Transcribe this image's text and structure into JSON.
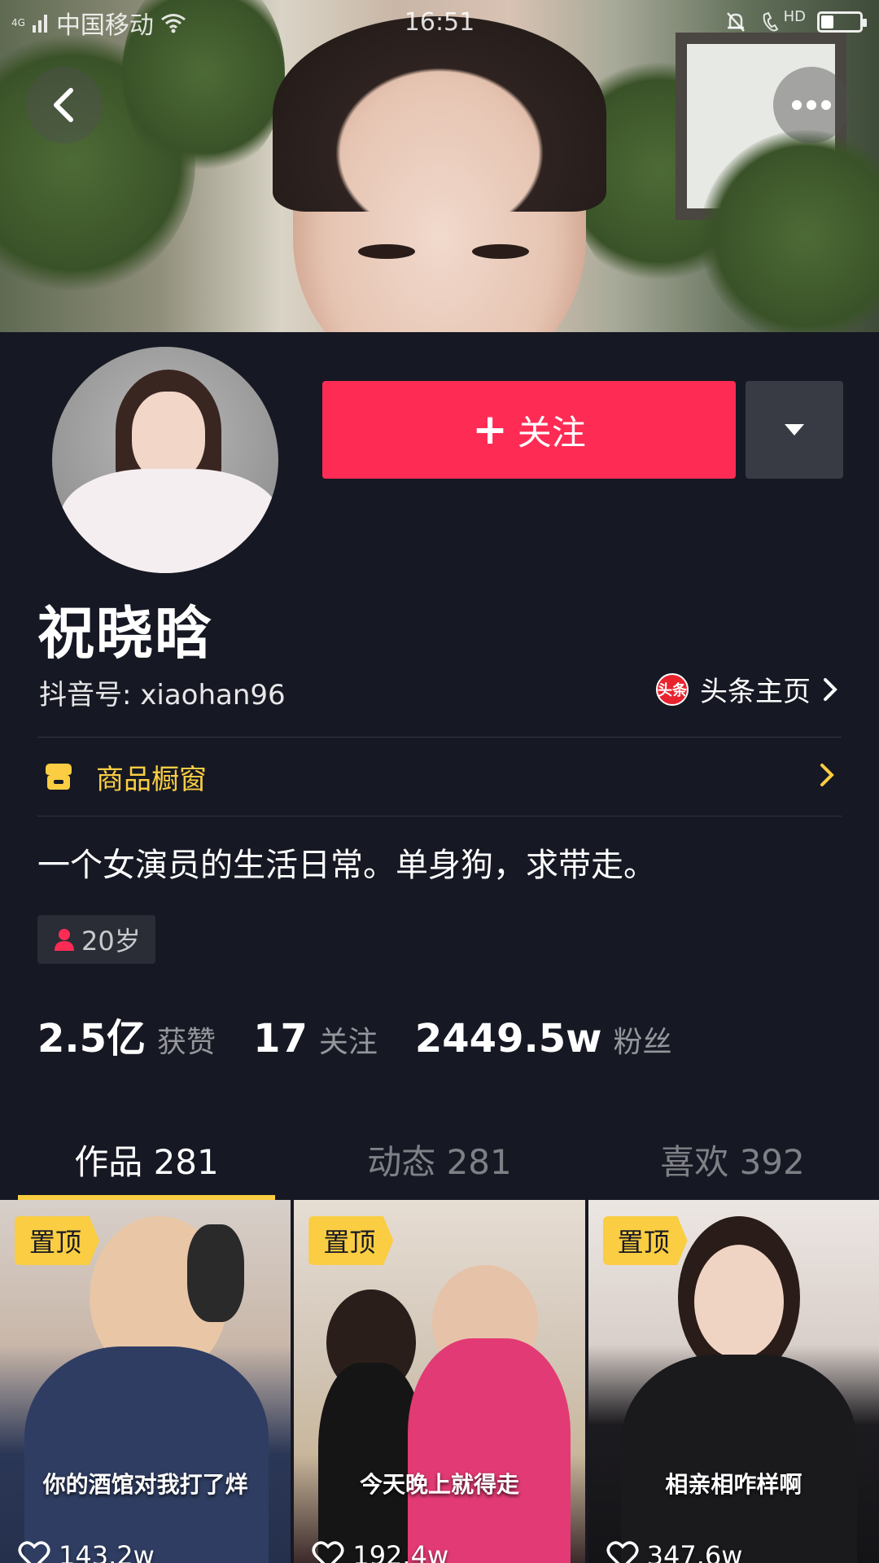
{
  "status_bar": {
    "network": "4G",
    "carrier": "中国移动",
    "time": "16:51",
    "hd": "HD",
    "battery_level": 0.3
  },
  "header": {
    "back_icon": "chevron-left-icon",
    "more_icon": "ellipsis-icon"
  },
  "profile": {
    "name": "祝晓晗",
    "douyin_id": "抖音号: xiaohan96",
    "toutiao_badge": "头条",
    "toutiao_label": "头条主页",
    "follow_label": "关注",
    "shop_label": "商品橱窗",
    "bio": "一个女演员的生活日常。单身狗，求带走。",
    "age": "20岁"
  },
  "stats": [
    {
      "value": "2.5亿",
      "label": "获赞"
    },
    {
      "value": "17",
      "label": "关注"
    },
    {
      "value": "2449.5w",
      "label": "粉丝"
    }
  ],
  "tabs": [
    {
      "label": "作品 281",
      "active": true
    },
    {
      "label": "动态 281",
      "active": false
    },
    {
      "label": "喜欢 392",
      "active": false
    }
  ],
  "videos": [
    {
      "pin": "置顶",
      "caption": "你的酒馆对我打了烊",
      "likes": "143.2w"
    },
    {
      "pin": "置顶",
      "caption": "今天晚上就得走",
      "likes": "192.4w"
    },
    {
      "pin": "置顶",
      "caption": "相亲相咋样啊",
      "likes": "347.6w"
    }
  ],
  "colors": {
    "background": "#161823",
    "follow": "#fe2c55",
    "accent": "#facd42"
  }
}
